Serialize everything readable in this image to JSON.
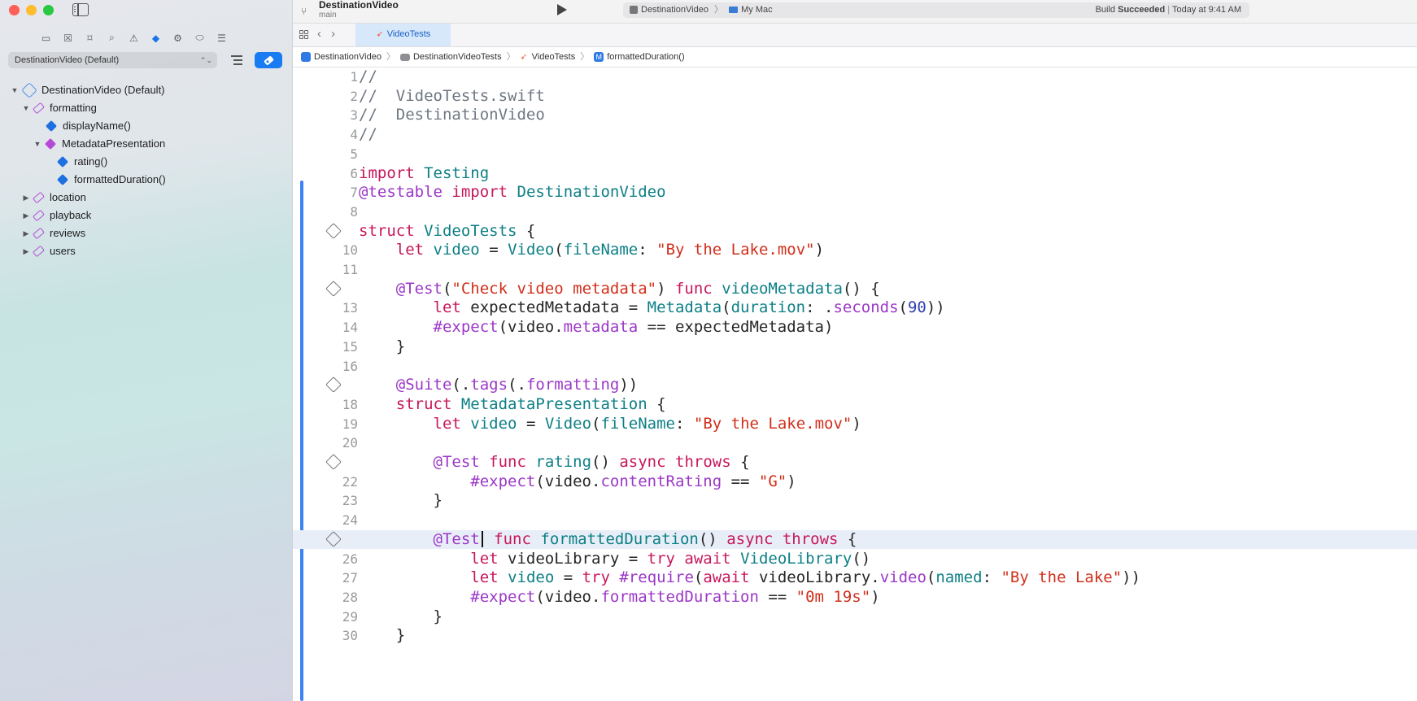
{
  "window": {
    "project": "DestinationVideo",
    "branch": "main",
    "scheme": "DestinationVideo",
    "destination": "My Mac",
    "build_status_prefix": "Build",
    "build_status_bold": "Succeeded",
    "build_time": "Today at 9:41 AM"
  },
  "sidebar": {
    "scheme_selector": "DestinationVideo (Default)",
    "tree": [
      {
        "label": "DestinationVideo (Default)",
        "kind": "plan",
        "expanded": true
      },
      {
        "label": "formatting",
        "kind": "tag",
        "expanded": true
      },
      {
        "label": "displayName()",
        "kind": "test"
      },
      {
        "label": "MetadataPresentation",
        "kind": "suite",
        "expanded": true
      },
      {
        "label": "rating()",
        "kind": "test"
      },
      {
        "label": "formattedDuration()",
        "kind": "test"
      },
      {
        "label": "location",
        "kind": "tag"
      },
      {
        "label": "playback",
        "kind": "tag"
      },
      {
        "label": "reviews",
        "kind": "tag"
      },
      {
        "label": "users",
        "kind": "tag"
      }
    ]
  },
  "tabs": [
    {
      "label": "VideoTests",
      "active": true
    }
  ],
  "breadcrumb": [
    "DestinationVideo",
    "DestinationVideoTests",
    "VideoTests",
    "formattedDuration()"
  ],
  "editor": {
    "lines": [
      "//",
      "//  VideoTests.swift",
      "//  DestinationVideo",
      "//",
      "",
      "import Testing",
      "@testable import DestinationVideo",
      "",
      "struct VideoTests {",
      "    let video = Video(fileName: \"By the Lake.mov\")",
      "",
      "    @Test(\"Check video metadata\") func videoMetadata() {",
      "        let expectedMetadata = Metadata(duration: .seconds(90))",
      "        #expect(video.metadata == expectedMetadata)",
      "    }",
      "",
      "    @Suite(.tags(.formatting))",
      "    struct MetadataPresentation {",
      "        let video = Video(fileName: \"By the Lake.mov\")",
      "",
      "        @Test func rating() async throws {",
      "            #expect(video.contentRating == \"G\")",
      "        }",
      "",
      "        @Test func formattedDuration() async throws {",
      "            let videoLibrary = try await VideoLibrary()",
      "            let video = try #require(await videoLibrary.video(named: \"By the Lake\"))",
      "            #expect(video.formattedDuration == \"0m 19s\")",
      "        }",
      "    }"
    ],
    "test_diamond_lines": [
      9,
      12,
      17,
      21,
      25
    ],
    "highlighted_line": 25
  },
  "colors": {
    "accent": "#1a7cf2",
    "keyword": "#c7175b",
    "attribute": "#9b37c7",
    "type": "#0d7f86",
    "string": "#d12f1b",
    "comment": "#6e7781",
    "number": "#2e3fb3"
  }
}
